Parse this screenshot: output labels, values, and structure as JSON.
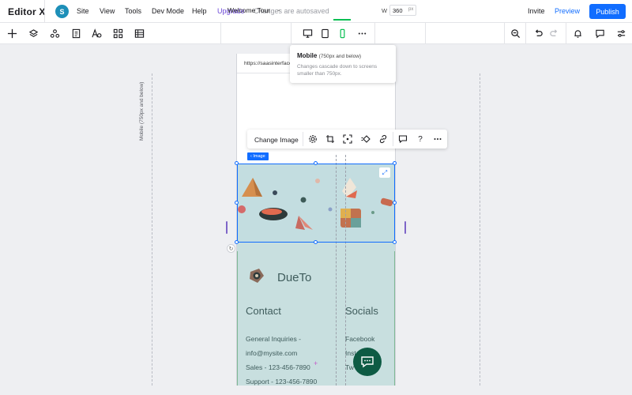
{
  "menubar": {
    "logo": "Editor X",
    "avatar_letter": "S",
    "items": [
      "Site",
      "View",
      "Tools",
      "Dev Mode",
      "Help"
    ],
    "upgrade": "Upgrade",
    "autosave": "Changes are autosaved",
    "invite": "Invite",
    "preview": "Preview",
    "publish": "Publish"
  },
  "toolbar": {
    "page": "Welcome Tour",
    "width_label": "W",
    "width_value": "360",
    "width_unit": "px"
  },
  "tooltip": {
    "title": "Mobile",
    "subtitle": "(750px and below)",
    "description": "Changes cascade down to screens smaller than 750px."
  },
  "canvas": {
    "breakpoint_label": "Mobile (750px and below)",
    "url": "https://saasinterface"
  },
  "context_toolbar": {
    "change_image": "Change Image"
  },
  "image_tag": "‹ Image",
  "site": {
    "brand": "DueTo",
    "contact_heading": "Contact",
    "socials_heading": "Socials",
    "contact_lines": [
      "General Inquiries -",
      "info@mysite.com",
      "Sales - 123-456-7890",
      "Support - 123-456-7890"
    ],
    "social_lines": [
      "Facebook",
      "Inst",
      "Tw"
    ]
  },
  "colors": {
    "accent": "#116dff",
    "upgrade": "#6a45d6",
    "mobile_active": "#0abf53",
    "site_teal": "#c8dfdf",
    "chat_button": "#0e5b44"
  }
}
